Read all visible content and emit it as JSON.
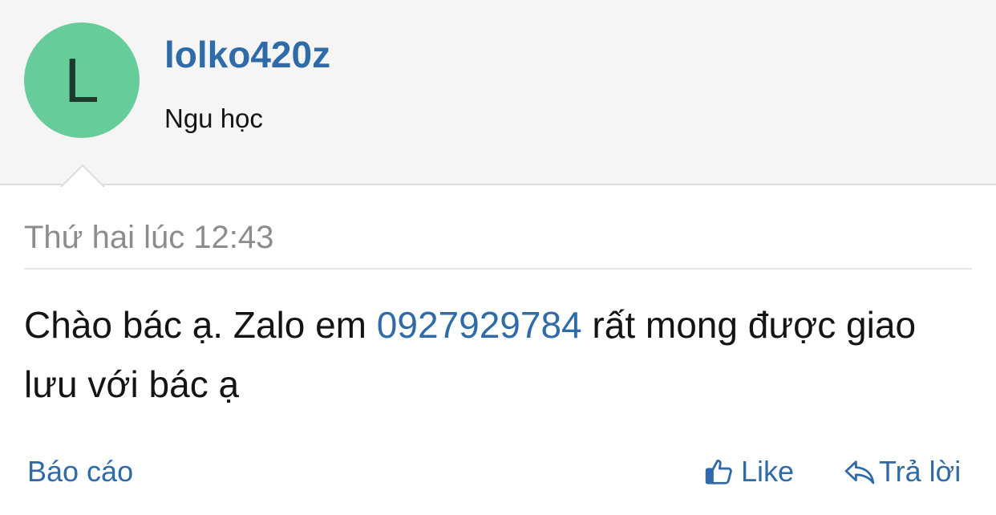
{
  "profile": {
    "avatar_letter": "L",
    "avatar_color": "#66cc99",
    "username": "lolko420z",
    "user_title": "Ngu học"
  },
  "post": {
    "timestamp": "Thứ hai lúc 12:43",
    "message_before": "Chào bác ạ. Zalo em ",
    "message_phone": "0927929784",
    "message_after": " rất mong được giao lưu với bác ạ"
  },
  "actions": {
    "report_label": "Báo cáo",
    "like_label": "Like",
    "like_icon": "thumbs-up-icon",
    "reply_label": "Trả lời",
    "reply_icon": "reply-arrow-icon"
  },
  "colors": {
    "link": "#2f6ba8",
    "header_bg": "#f5f5f5",
    "text": "#141414",
    "muted": "#8c8c8c"
  }
}
